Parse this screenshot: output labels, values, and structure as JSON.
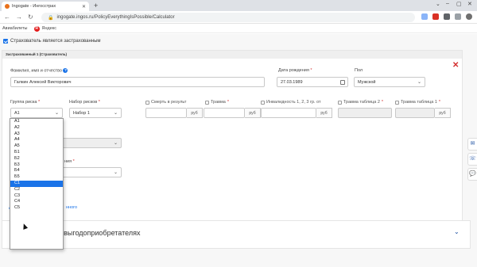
{
  "browser": {
    "tab_title": "Ingogate - Ингосстрах",
    "url": "ingogate.ingos.ru/PolicyEverythingIsPossible/Calculator",
    "bookmarks": [
      {
        "label": "Авиабилеты",
        "icon": "plane-icon"
      },
      {
        "label": "Яндекс",
        "icon": "yandex-icon"
      }
    ]
  },
  "form": {
    "insurer_is_insured_label": "Страхователь является застрахованным",
    "insured_header": "Застрахованный 1 (Страхователь)",
    "full_name_label": "Фамилия, имя и отчество",
    "full_name_value": "Галкин Алексей Викторович",
    "birth_date_label": "Дата рождения",
    "birth_date_value": "27.03.1989",
    "gender_label": "Пол",
    "gender_value": "Мужской",
    "risk_group_label": "Группа риска",
    "risk_group_value": "А1",
    "risk_set_label": "Набор рисков",
    "risk_set_value": "Набор 1",
    "risks": [
      {
        "label": "Смерть в результ",
        "unit": "руб"
      },
      {
        "label": "Травма",
        "unit": "руб"
      },
      {
        "label": "Инвалидность 1, 2, 3 гр. от",
        "unit": "руб"
      },
      {
        "label": "Травма таблица 2",
        "unit": ""
      },
      {
        "label": "Травма таблица 1",
        "unit": "руб"
      }
    ],
    "hidden_label_suffix": "ния",
    "link_text_1": "Д",
    "link_text_2": "нного"
  },
  "dropdown": {
    "options": [
      "А1",
      "А2",
      "А3",
      "А4",
      "А5",
      "Б1",
      "Б2",
      "Б3",
      "Б4",
      "Б5",
      "С1",
      "С2",
      "С3",
      "С4",
      "С5"
    ],
    "highlighted": "С1"
  },
  "beneficiaries": {
    "title": "Информация о выгодоприобретателях"
  },
  "colors": {
    "accent": "#1a73e8",
    "danger": "#d32f2f",
    "brand": "#1a4ea0"
  }
}
